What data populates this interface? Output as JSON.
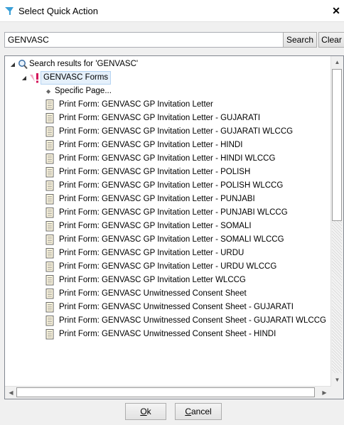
{
  "window": {
    "title": "Select Quick Action",
    "close_glyph": "✕"
  },
  "search": {
    "value": "GENVASC",
    "button_label": "Search",
    "clear_label": "Clear"
  },
  "tree": {
    "root_label": "Search results for 'GENVASC'",
    "group_label": "GENVASC Forms",
    "specific_page_label": "Specific Page...",
    "items": [
      "Print Form: GENVASC GP Invitation Letter",
      "Print Form: GENVASC GP Invitation Letter - GUJARATI",
      "Print Form: GENVASC GP Invitation Letter - GUJARATI WLCCG",
      "Print Form: GENVASC GP Invitation Letter - HINDI",
      "Print Form: GENVASC GP Invitation Letter - HINDI WLCCG",
      "Print Form: GENVASC GP Invitation Letter - POLISH",
      "Print Form: GENVASC GP Invitation Letter - POLISH WLCCG",
      "Print Form: GENVASC GP Invitation Letter - PUNJABI",
      "Print Form: GENVASC GP Invitation Letter - PUNJABI WLCCG",
      "Print Form: GENVASC GP Invitation Letter - SOMALI",
      "Print Form: GENVASC GP Invitation Letter - SOMALI WLCCG",
      "Print Form: GENVASC GP Invitation Letter - URDU",
      "Print Form: GENVASC GP Invitation Letter - URDU WLCCG",
      "Print Form: GENVASC GP Invitation Letter WLCCG",
      "Print Form: GENVASC Unwitnessed Consent Sheet",
      "Print Form: GENVASC Unwitnessed Consent Sheet - GUJARATI",
      "Print Form: GENVASC Unwitnessed Consent Sheet - GUJARATI WLCCG",
      "Print Form: GENVASC Unwitnessed Consent Sheet - HINDI"
    ]
  },
  "buttons": {
    "ok_mnemonic": "O",
    "ok_rest": "k",
    "cancel_mnemonic": "C",
    "cancel_rest": "ancel"
  },
  "colors": {
    "selection": "#e5f0fb",
    "selection_border": "#b6d4f2",
    "group_icon": "#e0457b"
  }
}
